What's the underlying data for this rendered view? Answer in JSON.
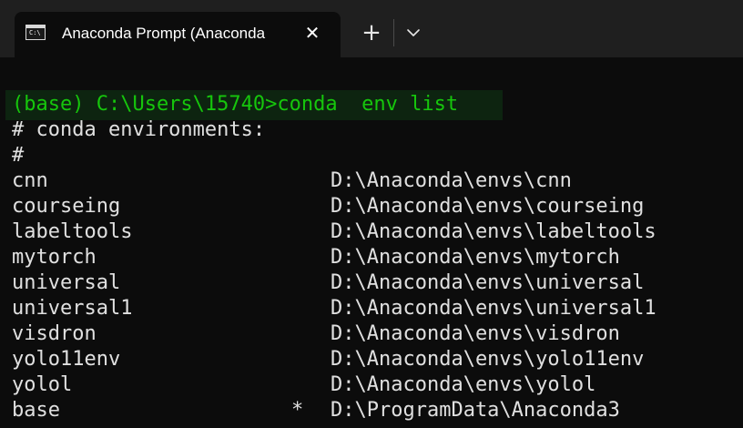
{
  "titlebar": {
    "tab_title": "Anaconda Prompt (Anaconda",
    "tab_icon": "terminal-icon",
    "tab_icon_glyph": "C:\\",
    "close_glyph": "✕",
    "new_tab_glyph": "+",
    "dropdown_icon": "chevron-down-icon"
  },
  "console": {
    "command_line": "(base) C:\\Users\\15740>conda  env list",
    "header_line": "# conda environments:",
    "hash_line": "#",
    "environments": [
      {
        "name": "cnn",
        "marker": "",
        "path": "D:\\Anaconda\\envs\\cnn"
      },
      {
        "name": "courseing",
        "marker": "",
        "path": "D:\\Anaconda\\envs\\courseing"
      },
      {
        "name": "labeltools",
        "marker": "",
        "path": "D:\\Anaconda\\envs\\labeltools"
      },
      {
        "name": "mytorch",
        "marker": "",
        "path": "D:\\Anaconda\\envs\\mytorch"
      },
      {
        "name": "universal",
        "marker": "",
        "path": "D:\\Anaconda\\envs\\universal"
      },
      {
        "name": "universal1",
        "marker": "",
        "path": "D:\\Anaconda\\envs\\universal1"
      },
      {
        "name": "visdron",
        "marker": "",
        "path": "D:\\Anaconda\\envs\\visdron"
      },
      {
        "name": "yolo11env",
        "marker": "",
        "path": "D:\\Anaconda\\envs\\yolo11env"
      },
      {
        "name": "yolol",
        "marker": "",
        "path": "D:\\Anaconda\\envs\\yolol"
      },
      {
        "name": "base",
        "marker": "*",
        "path": "D:\\ProgramData\\Anaconda3"
      }
    ]
  },
  "colors": {
    "background": "#0c0c0c",
    "titlebar": "#1f1f1f",
    "text": "#e0e0e0",
    "command_green": "#16c60c"
  }
}
